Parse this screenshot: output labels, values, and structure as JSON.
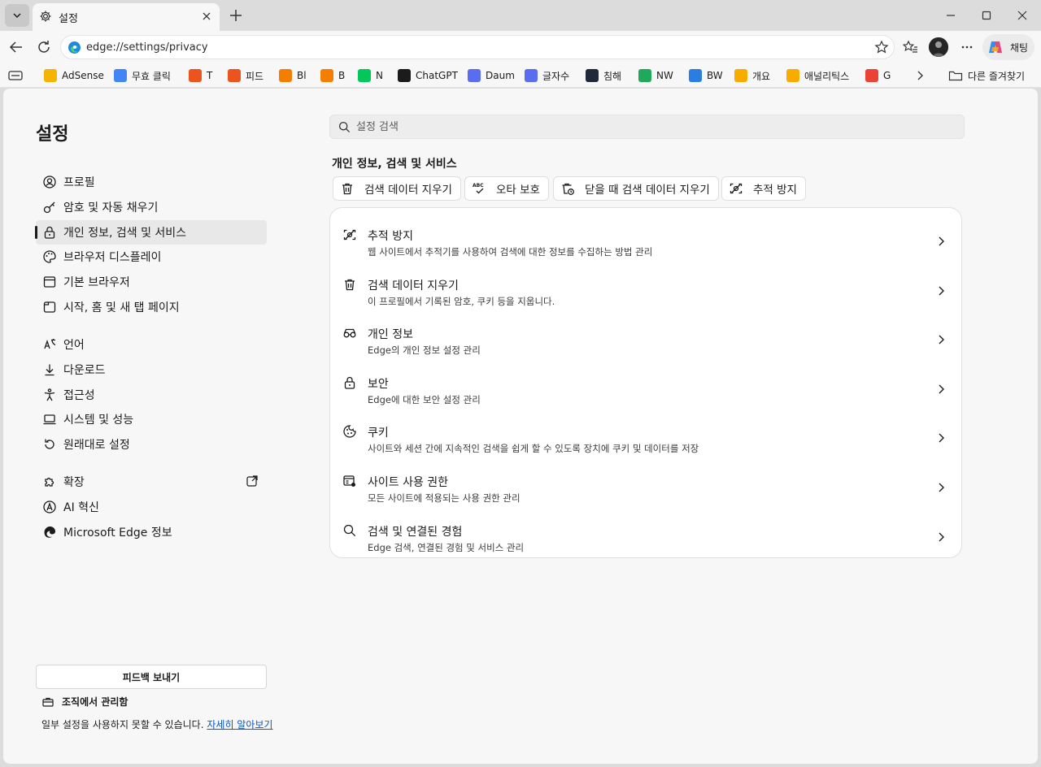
{
  "colors": {
    "chrome_bg": "#dcdcdc",
    "toolbar_bg": "#f7f7f7",
    "page_bg": "#f7f7f7",
    "card_bg": "#ffffff",
    "link": "#0f58b8"
  },
  "tab": {
    "title": "설정",
    "icon": "gear-icon"
  },
  "address": {
    "url": "edge://settings/privacy"
  },
  "copilot": {
    "label": "채팅"
  },
  "favorites": [
    {
      "label": "AdSense",
      "icon": "adsense-icon",
      "color": "#f4b400"
    },
    {
      "label": "무효 클릭",
      "icon": "google-icon",
      "color": "#4285f4"
    },
    {
      "label": "T",
      "icon": "tistory-icon",
      "color": "#eb531f"
    },
    {
      "label": "피드",
      "icon": "tistory-icon",
      "color": "#eb531f"
    },
    {
      "label": "Bl",
      "icon": "blogger-icon",
      "color": "#f57d00"
    },
    {
      "label": "B",
      "icon": "blogger-icon",
      "color": "#f57d00"
    },
    {
      "label": "N",
      "icon": "naver-icon",
      "color": "#03c75a"
    },
    {
      "label": "ChatGPT",
      "icon": "chatgpt-icon",
      "color": "#1b1b1b"
    },
    {
      "label": "Daum",
      "icon": "daum-icon",
      "color": "#5a6df0"
    },
    {
      "label": "글자수",
      "icon": "daum-icon",
      "color": "#5a6df0"
    },
    {
      "label": "침해",
      "icon": "d-icon",
      "color": "#1e2a3a"
    },
    {
      "label": "NW",
      "icon": "monitor-icon",
      "color": "#21a95b"
    },
    {
      "label": "BW",
      "icon": "bing-icon",
      "color": "#2a7de1"
    },
    {
      "label": "개요",
      "icon": "analytics-icon",
      "color": "#f9ab00"
    },
    {
      "label": "애널리틱스",
      "icon": "analytics-icon",
      "color": "#f9ab00"
    },
    {
      "label": "G",
      "icon": "gmail-icon",
      "color": "#ea4335"
    }
  ],
  "favorites_folder": {
    "label": "다른 즐겨찾기"
  },
  "sidebar": {
    "title": "설정",
    "items": [
      {
        "label": "프로필",
        "icon": "profile-icon"
      },
      {
        "label": "암호 및 자동 채우기",
        "icon": "key-icon"
      },
      {
        "label": "개인 정보, 검색 및 서비스",
        "icon": "lock-icon"
      },
      {
        "label": "브라우저 디스플레이",
        "icon": "palette-icon"
      },
      {
        "label": "기본 브라우저",
        "icon": "browser-icon"
      },
      {
        "label": "시작, 홈 및 새 탭 페이지",
        "icon": "home-tab-icon"
      },
      {
        "label": "언어",
        "icon": "language-icon"
      },
      {
        "label": "다운로드",
        "icon": "download-icon"
      },
      {
        "label": "접근성",
        "icon": "accessibility-icon"
      },
      {
        "label": "시스템 및 성능",
        "icon": "laptop-icon"
      },
      {
        "label": "원래대로 설정",
        "icon": "reset-icon"
      },
      {
        "label": "확장",
        "icon": "puzzle-icon"
      },
      {
        "label": "AI 혁신",
        "icon": "ai-icon"
      },
      {
        "label": "Microsoft Edge 정보",
        "icon": "edge-icon"
      }
    ],
    "active_index": 2,
    "feedback_label": "피드백 보내기",
    "org_label": "조직에서 관리함",
    "org_note": "일부 설정을 사용하지 못할 수 있습니다.",
    "org_link": "자세히 알아보기"
  },
  "search": {
    "placeholder": "설정 검색"
  },
  "main": {
    "section_title": "개인 정보, 검색 및 서비스",
    "chips": [
      {
        "label": "검색 데이터 지우기",
        "icon": "trash-icon"
      },
      {
        "label": "오타 보호",
        "icon": "spellcheck-icon"
      },
      {
        "label": "닫을 때 검색 데이터 지우기",
        "icon": "trash-clock-icon"
      },
      {
        "label": "추적 방지",
        "icon": "tracking-icon"
      }
    ],
    "rows": [
      {
        "title": "추적 방지",
        "desc": "웹 사이트에서 추적기를 사용하여 검색에 대한 정보를 수집하는 방법 관리",
        "icon": "tracking-icon"
      },
      {
        "title": "검색 데이터 지우기",
        "desc": "이 프로필에서 기록된 암호, 쿠키 등을 지웁니다.",
        "icon": "trash-icon"
      },
      {
        "title": "개인 정보",
        "desc": "Edge의 개인 정보 설정 관리",
        "icon": "glasses-icon"
      },
      {
        "title": "보안",
        "desc": "Edge에 대한 보안 설정 관리",
        "icon": "lock-icon"
      },
      {
        "title": "쿠키",
        "desc": "사이트와 세션 간에 지속적인 검색을 쉽게 할 수 있도록 장치에 쿠키 및 데이터를 저장",
        "icon": "cookie-icon"
      },
      {
        "title": "사이트 사용 권한",
        "desc": "모든 사이트에 적용되는 사용 권한 관리",
        "icon": "site-permissions-icon"
      },
      {
        "title": "검색 및 연결된 경험",
        "desc": "Edge 검색, 연결된 경험 및 서비스 관리",
        "icon": "search-icon"
      }
    ]
  }
}
